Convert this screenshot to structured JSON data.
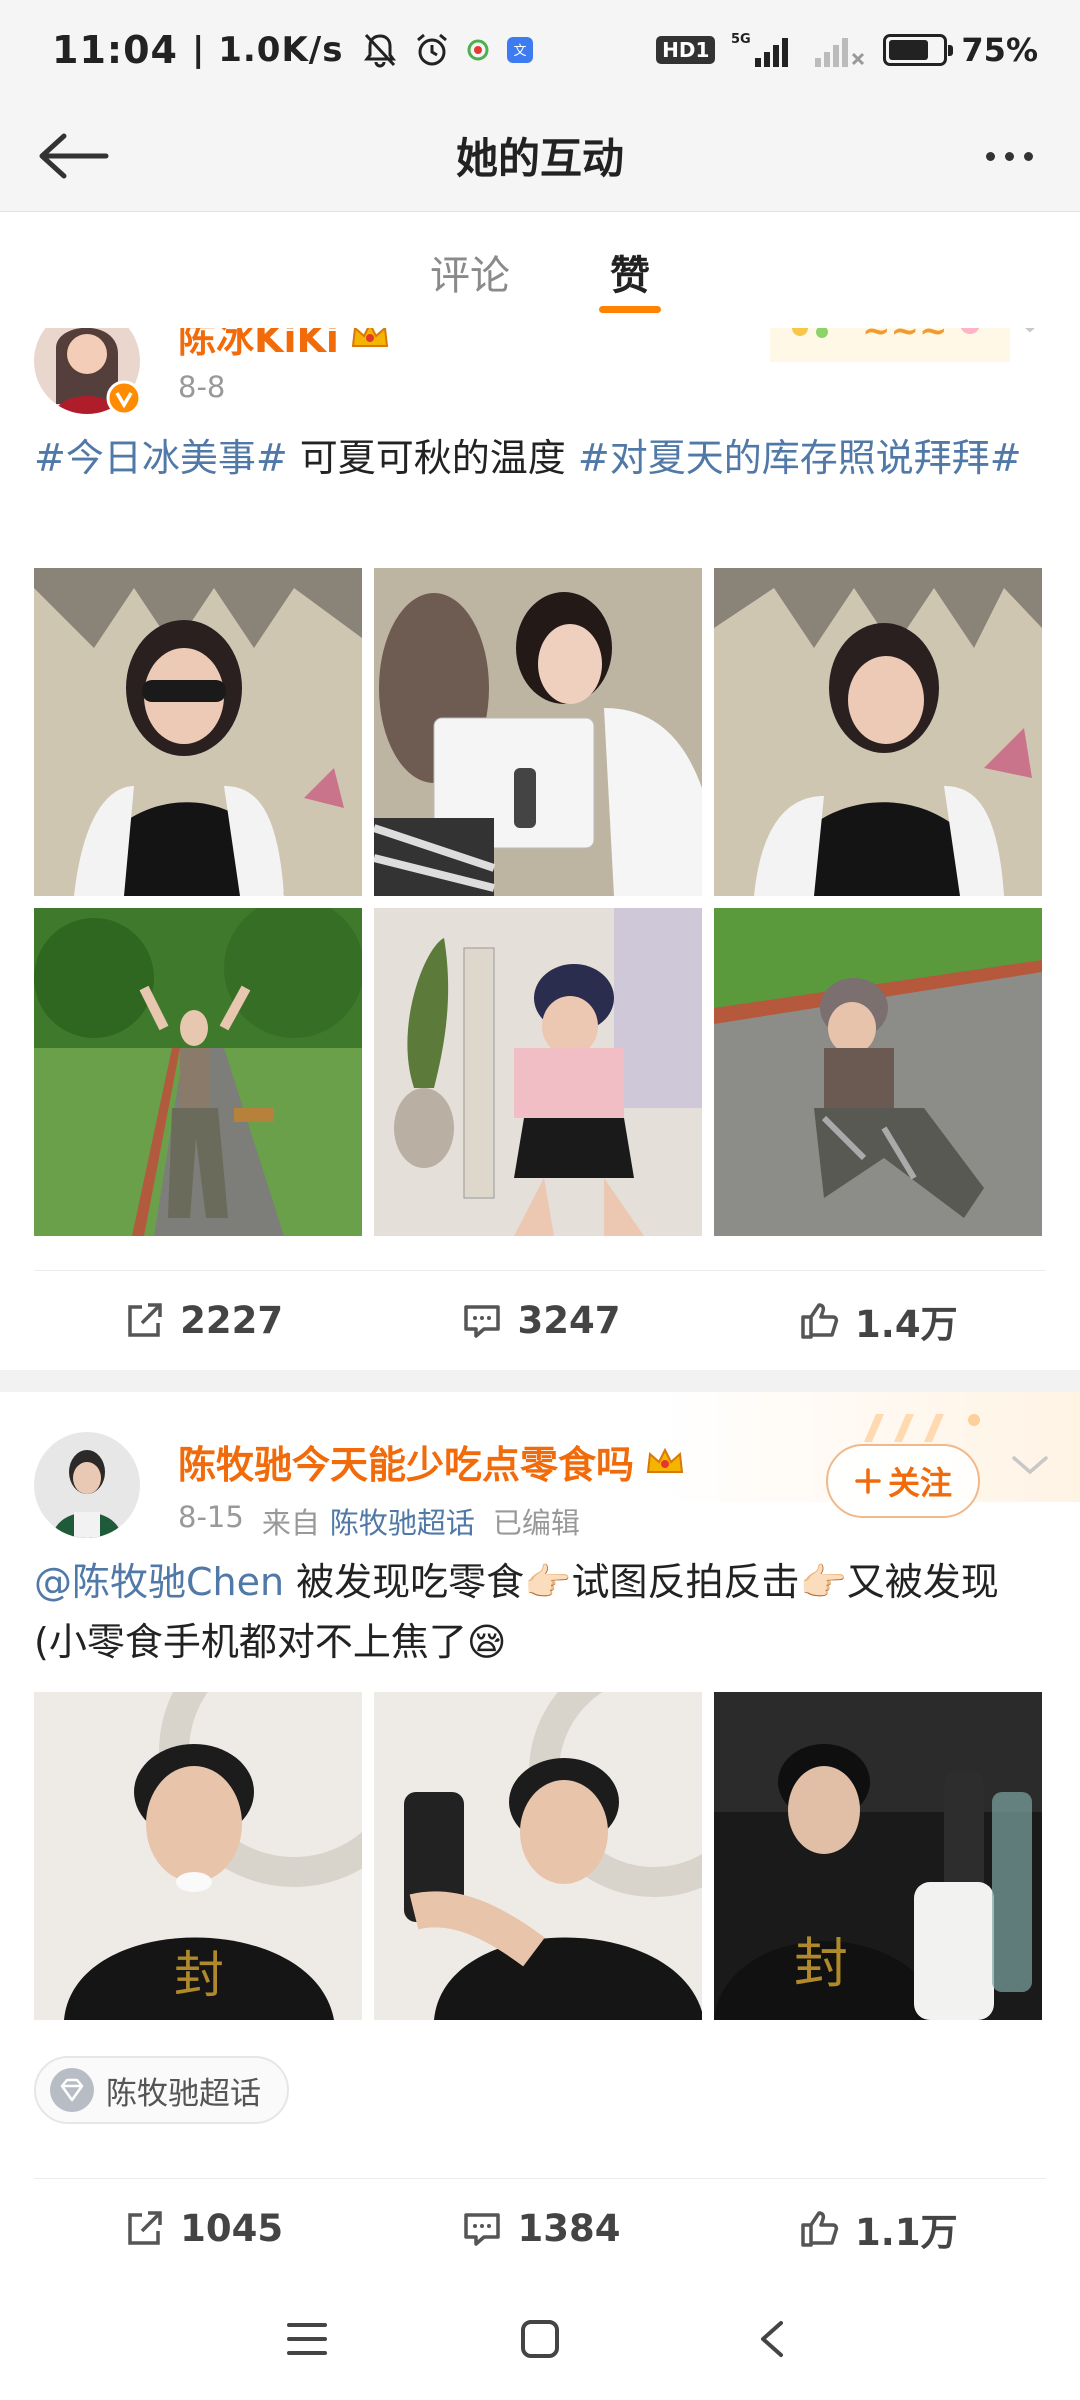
{
  "status_bar": {
    "time": "11:04",
    "speed": "| 1.0K/s",
    "network_badge": "HD1",
    "signal_label": "5G",
    "battery_level": 0.75,
    "battery_text": "75%"
  },
  "header": {
    "title": "她的互动"
  },
  "tabs": [
    {
      "label": "评论",
      "active": false
    },
    {
      "label": "赞",
      "active": true
    }
  ],
  "posts": [
    {
      "author": "陈冰KiKi",
      "date": "8-8",
      "text_parts": [
        {
          "type": "tag",
          "text": "#今日冰美事#"
        },
        {
          "type": "text",
          "text": " 可夏可秋的温度 "
        },
        {
          "type": "tag",
          "text": "#对夏天的库存照说拜拜#"
        }
      ],
      "photo_count": 6,
      "stats": {
        "repost": "2227",
        "comment": "3247",
        "like": "1.4万"
      }
    },
    {
      "author": "陈牧驰今天能少吃点零食吗",
      "date": "8-15",
      "source_prefix": "来自",
      "source": "陈牧驰超话",
      "edited": "已编辑",
      "follow_label": "关注",
      "text_parts": [
        {
          "type": "tag",
          "text": "@陈牧驰Chen"
        },
        {
          "type": "text",
          "text": " 被发现吃零食👉🏻试图反拍反击👉🏻又被发现(小零食手机都对不上焦了😪"
        }
      ],
      "photo_count": 3,
      "supertopic": "陈牧驰超话",
      "stats": {
        "repost": "1045",
        "comment": "1384",
        "like": "1.1万"
      }
    }
  ],
  "colors": {
    "accent": "#ff8200",
    "author": "#f26b0a",
    "link": "#5079a8"
  }
}
